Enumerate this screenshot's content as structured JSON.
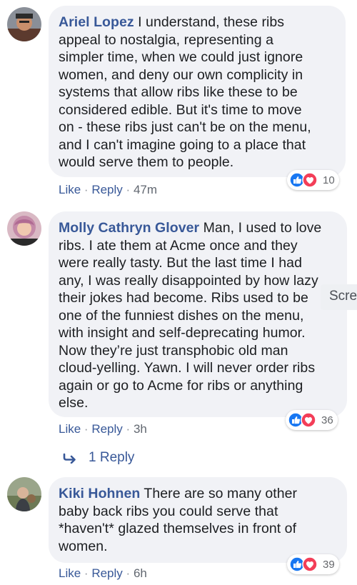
{
  "comments": [
    {
      "author": "Ariel Lopez",
      "lines": [
        " I understand, these ribs",
        "appeal to nostalgia, representing a",
        "simpler time, when we could just ignore",
        "women, and deny our own complicity in",
        "systems that allow ribs like these to be",
        "considered edible. But it's time to move",
        "on - these ribs just can't be on the menu,",
        "and I can't imagine going to a place that",
        "would serve them to people."
      ],
      "like_label": "Like",
      "reply_label": "Reply",
      "time": "47m",
      "reaction_count": "10"
    },
    {
      "author": "Molly Cathryn Glover",
      "lines": [
        " Man, I used to love",
        "ribs. I ate them at Acme once and they",
        "were really tasty. But the last time I had",
        "any, I was really disappointed by how lazy",
        "their jokes had become. Ribs used to be",
        "one of the funniest dishes on the menu,",
        "with insight and self-deprecating humor.",
        "Now they’re just transphobic old man",
        "cloud-yelling. Yawn. I will never order ribs",
        "again or go to Acme for ribs or anything",
        "else."
      ],
      "like_label": "Like",
      "reply_label": "Reply",
      "time": "3h",
      "reaction_count": "36"
    },
    {
      "author": "Kiki Hohnen",
      "lines": [
        " There are so many other",
        "baby back ribs you could serve that",
        "*haven't* glazed themselves in front of",
        "women."
      ],
      "like_label": "Like",
      "reply_label": "Reply",
      "time": "6h",
      "reaction_count": "39"
    }
  ],
  "replies_link": {
    "label": "1 Reply"
  },
  "tooltip_fragment": {
    "text": "Scre"
  },
  "separator": "·",
  "colors": {
    "link": "#385898",
    "bubble": "#f1f2f6",
    "like_blue": "#1877f2",
    "love_red": "#f33e58"
  }
}
